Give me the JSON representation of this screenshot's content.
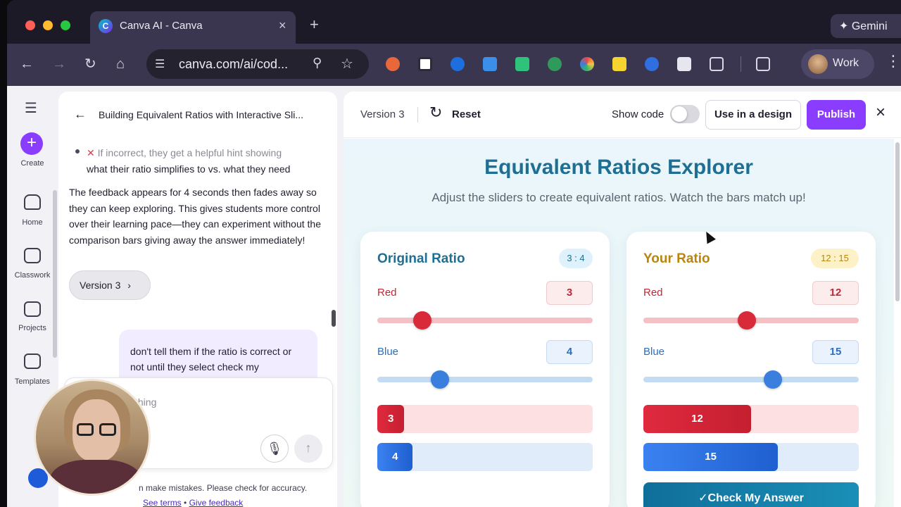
{
  "browser": {
    "tab_title": "Canva AI - Canva",
    "tab_close": "×",
    "new_tab": "+",
    "gemini_label": "✦ Gemini",
    "url": "canva.com/ai/cod...",
    "profile_label": "Work"
  },
  "rail": {
    "create_label": "Create",
    "items": [
      {
        "label": "Home",
        "icon": "home-icon"
      },
      {
        "label": "Classwork",
        "icon": "graduation-cap-icon"
      },
      {
        "label": "Projects",
        "icon": "folder-icon"
      },
      {
        "label": "Templates",
        "icon": "templates-icon"
      }
    ]
  },
  "chat": {
    "title": "Building Equivalent Ratios with Interactive Sli...",
    "bullet_incorrect_1": "If incorrect, they get a helpful hint showing",
    "bullet_incorrect_2": "what their ratio simplifies to vs. what they need",
    "paragraph": "The feedback appears for 4 seconds then fades away so they can keep exploring. This gives students more control over their learning pace—they can experiment without the comparison bars giving away the answer immediately!",
    "version_chip": "Version 3",
    "user_message": "don't tell them if the ratio is correct or not until they select check my",
    "input_placeholder": "thing",
    "disclaimer": "n make mistakes. Please check for accuracy.",
    "see_terms": "See terms",
    "give_feedback": "Give feedback",
    "separator": "•"
  },
  "preview": {
    "version": "Version 3",
    "reset": "Reset",
    "show_code": "Show code",
    "use_in_design": "Use in a design",
    "publish": "Publish",
    "close": "×",
    "app_title": "Equivalent Ratios Explorer",
    "app_subtitle": "Adjust the sliders to create equivalent ratios. Watch the bars match up!",
    "original": {
      "title": "Original Ratio",
      "badge": "3 : 4",
      "red_label": "Red",
      "red_value": "3",
      "blue_label": "Blue",
      "blue_value": "4",
      "red_slider_fraction": 0.21,
      "blue_slider_fraction": 0.29,
      "red_bar_fraction": 0.125,
      "blue_bar_fraction": 0.165
    },
    "yours": {
      "title": "Your Ratio",
      "badge": "12 : 15",
      "red_label": "Red",
      "red_value": "12",
      "blue_label": "Blue",
      "blue_value": "15",
      "red_slider_fraction": 0.48,
      "blue_slider_fraction": 0.6,
      "red_bar_fraction": 0.5,
      "blue_bar_fraction": 0.625,
      "check_button": "✓Check My Answer"
    }
  },
  "colors": {
    "canva_purple": "#8b3dff",
    "title_teal": "#1e6f93",
    "red": "#d92a3a",
    "blue": "#3a7fde"
  }
}
